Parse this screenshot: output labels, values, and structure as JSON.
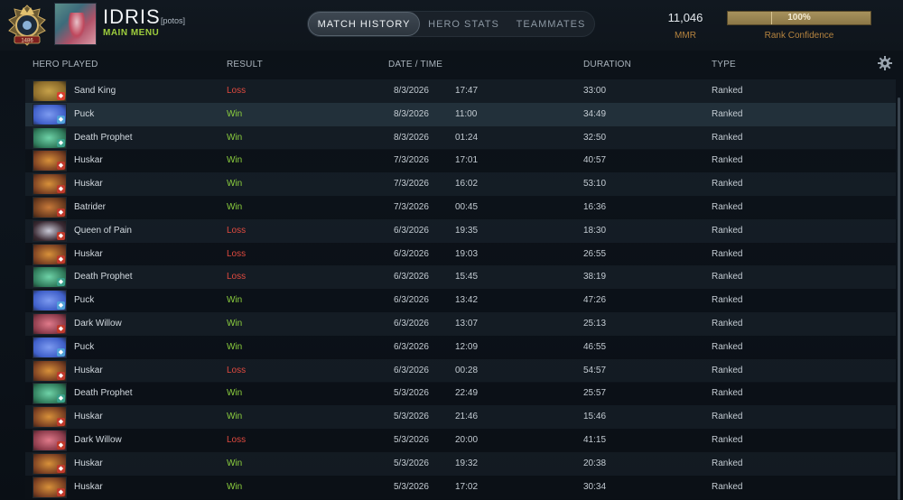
{
  "player": {
    "name": "IDRIS",
    "tag": "[potos]",
    "main_menu": "MAIN MENU",
    "medal_label": "1486"
  },
  "tabs": [
    {
      "label": "MATCH HISTORY",
      "active": true
    },
    {
      "label": "HERO STATS",
      "active": false
    },
    {
      "label": "TEAMMATES",
      "active": false
    }
  ],
  "stats": {
    "mmr_value": "11,046",
    "mmr_label": "MMR",
    "confidence_value": "100%",
    "confidence_fraction": 1.0,
    "confidence_label": "Rank Confidence"
  },
  "columns": {
    "hero": "HERO PLAYED",
    "result": "RESULT",
    "date": "DATE / TIME",
    "duration": "DURATION",
    "type": "TYPE"
  },
  "colors": {
    "win": "#8ccf3e",
    "loss": "#e04a3f",
    "accent": "#b5833f"
  },
  "matches": [
    {
      "hero": "Sand King",
      "result": "Loss",
      "date": "8/3/2026",
      "time": "17:47",
      "duration": "33:00",
      "type": "Ranked"
    },
    {
      "hero": "Puck",
      "result": "Win",
      "date": "8/3/2026",
      "time": "11:00",
      "duration": "34:49",
      "type": "Ranked"
    },
    {
      "hero": "Death Prophet",
      "result": "Win",
      "date": "8/3/2026",
      "time": "01:24",
      "duration": "32:50",
      "type": "Ranked"
    },
    {
      "hero": "Huskar",
      "result": "Win",
      "date": "7/3/2026",
      "time": "17:01",
      "duration": "40:57",
      "type": "Ranked"
    },
    {
      "hero": "Huskar",
      "result": "Win",
      "date": "7/3/2026",
      "time": "16:02",
      "duration": "53:10",
      "type": "Ranked"
    },
    {
      "hero": "Batrider",
      "result": "Win",
      "date": "7/3/2026",
      "time": "00:45",
      "duration": "16:36",
      "type": "Ranked"
    },
    {
      "hero": "Queen of Pain",
      "result": "Loss",
      "date": "6/3/2026",
      "time": "19:35",
      "duration": "18:30",
      "type": "Ranked"
    },
    {
      "hero": "Huskar",
      "result": "Loss",
      "date": "6/3/2026",
      "time": "19:03",
      "duration": "26:55",
      "type": "Ranked"
    },
    {
      "hero": "Death Prophet",
      "result": "Loss",
      "date": "6/3/2026",
      "time": "15:45",
      "duration": "38:19",
      "type": "Ranked"
    },
    {
      "hero": "Puck",
      "result": "Win",
      "date": "6/3/2026",
      "time": "13:42",
      "duration": "47:26",
      "type": "Ranked"
    },
    {
      "hero": "Dark Willow",
      "result": "Win",
      "date": "6/3/2026",
      "time": "13:07",
      "duration": "25:13",
      "type": "Ranked"
    },
    {
      "hero": "Puck",
      "result": "Win",
      "date": "6/3/2026",
      "time": "12:09",
      "duration": "46:55",
      "type": "Ranked"
    },
    {
      "hero": "Huskar",
      "result": "Loss",
      "date": "6/3/2026",
      "time": "00:28",
      "duration": "54:57",
      "type": "Ranked"
    },
    {
      "hero": "Death Prophet",
      "result": "Win",
      "date": "5/3/2026",
      "time": "22:49",
      "duration": "25:57",
      "type": "Ranked"
    },
    {
      "hero": "Huskar",
      "result": "Win",
      "date": "5/3/2026",
      "time": "21:46",
      "duration": "15:46",
      "type": "Ranked"
    },
    {
      "hero": "Dark Willow",
      "result": "Loss",
      "date": "5/3/2026",
      "time": "20:00",
      "duration": "41:15",
      "type": "Ranked"
    },
    {
      "hero": "Huskar",
      "result": "Win",
      "date": "5/3/2026",
      "time": "19:32",
      "duration": "20:38",
      "type": "Ranked"
    },
    {
      "hero": "Huskar",
      "result": "Win",
      "date": "5/3/2026",
      "time": "17:02",
      "duration": "30:34",
      "type": "Ranked"
    }
  ]
}
